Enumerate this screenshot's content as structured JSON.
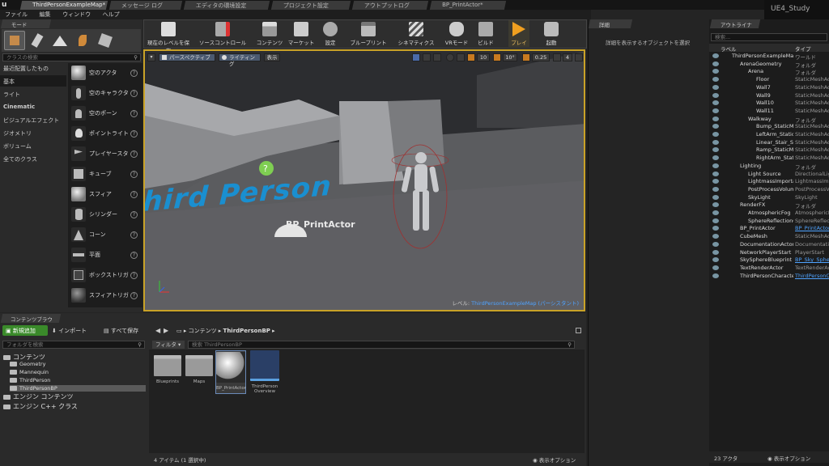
{
  "window_tabs": [
    "ThirdPersonExampleMap*",
    "メッセージ ログ",
    "エディタの環境設定",
    "プロジェクト設定",
    "アウトプットログ",
    "BP_PrintActor*"
  ],
  "app_title": "UE4_Study",
  "menu": [
    "ファイル",
    "編集",
    "ウィンドウ",
    "ヘルプ"
  ],
  "modes": {
    "tab": "モード",
    "search_placeholder": "クラスの検索",
    "categories": [
      "最近配置したもの",
      "基本",
      "ライト",
      "Cinematic",
      "ビジュアルエフェクト",
      "ジオメトリ",
      "ボリューム",
      "全てのクラス"
    ],
    "items": [
      "空のアクタ",
      "空のキャラクタ",
      "空のポーン",
      "ポイントライト",
      "プレイヤースタ",
      "キューブ",
      "スフィア",
      "シリンダー",
      "コーン",
      "平面",
      "ボックストリガ",
      "スフィアトリガ"
    ]
  },
  "toolbar": {
    "buttons": [
      "現在のレベルを保存",
      "ソースコントロール",
      "コンテンツ",
      "マーケット",
      "設定",
      "ブループリント",
      "シネマティクス",
      "VRモード",
      "ビルド",
      "プレイ",
      "起動"
    ]
  },
  "viewport": {
    "perspective": "パースペクティブ",
    "lighting": "ライティング",
    "show": "表示",
    "grid_snap": "10",
    "rot_snap": "10°",
    "scale_snap": "0.25",
    "cam_speed": "4",
    "floor_text": "Third Person",
    "actor_label": "BP_PrintActor",
    "level_label": "レベル:",
    "level_name": "ThirdPersonExampleMap (パーシスタント)"
  },
  "details": {
    "tab": "詳細",
    "empty": "詳細を表示するオブジェクトを選択"
  },
  "outliner": {
    "tab": "アウトライナ",
    "search_placeholder": "検索...",
    "col_label": "ラベル",
    "col_type": "タイプ",
    "rows": [
      {
        "name": "ThirdPersonExampleMap",
        "type": "ワールド",
        "indent": 0
      },
      {
        "name": "ArenaGeometry",
        "type": "フォルダ",
        "indent": 1
      },
      {
        "name": "Arena",
        "type": "フォルダ",
        "indent": 2
      },
      {
        "name": "Floor",
        "type": "StaticMeshActor",
        "indent": 3
      },
      {
        "name": "Wall7",
        "type": "StaticMeshActor",
        "indent": 3
      },
      {
        "name": "Wall9",
        "type": "StaticMeshActor",
        "indent": 3
      },
      {
        "name": "Wall10",
        "type": "StaticMeshActor",
        "indent": 3
      },
      {
        "name": "Wall11",
        "type": "StaticMeshActor",
        "indent": 3
      },
      {
        "name": "Walkway",
        "type": "フォルダ",
        "indent": 2
      },
      {
        "name": "Bump_StaticMesh",
        "type": "StaticMeshActor",
        "indent": 3
      },
      {
        "name": "LeftArm_StaticMes",
        "type": "StaticMeshActor",
        "indent": 3
      },
      {
        "name": "Linear_Stair_Static",
        "type": "StaticMeshActor",
        "indent": 3
      },
      {
        "name": "Ramp_StaticMesh",
        "type": "StaticMeshActor",
        "indent": 3
      },
      {
        "name": "RightArm_StaticMe",
        "type": "StaticMeshActor",
        "indent": 3
      },
      {
        "name": "Lighting",
        "type": "フォルダ",
        "indent": 1
      },
      {
        "name": "Light Source",
        "type": "DirectionalLight",
        "indent": 2
      },
      {
        "name": "LightmassImportanc",
        "type": "LightmassImportanceVolume",
        "indent": 2
      },
      {
        "name": "PostProcessVolume",
        "type": "PostProcessVolume",
        "indent": 2
      },
      {
        "name": "SkyLight",
        "type": "SkyLight",
        "indent": 2
      },
      {
        "name": "RenderFX",
        "type": "フォルダ",
        "indent": 1
      },
      {
        "name": "AtmosphericFog",
        "type": "AtmosphericFog",
        "indent": 2
      },
      {
        "name": "SphereReflectionCap",
        "type": "SphereReflectionCapture",
        "indent": 2
      },
      {
        "name": "BP_PrintActor",
        "type": "BP_PrintActor",
        "indent": 1,
        "link": true
      },
      {
        "name": "CubeMesh",
        "type": "StaticMeshActor",
        "indent": 1
      },
      {
        "name": "DocumentationActor1",
        "type": "DocumentationActor",
        "indent": 1
      },
      {
        "name": "NetworkPlayerStart",
        "type": "PlayerStart",
        "indent": 1
      },
      {
        "name": "SkySphereBlueprint",
        "type": "BP_Sky_Sphere",
        "indent": 1,
        "link": true
      },
      {
        "name": "TextRenderActor",
        "type": "TextRenderActor",
        "indent": 1
      },
      {
        "name": "ThirdPersonCharacter",
        "type": "ThirdPersonCharacter",
        "indent": 1,
        "link": true
      }
    ],
    "count": "23 アクタ",
    "view_options": "表示オプション"
  },
  "content_browser": {
    "tab": "コンテンツブラウザ",
    "add_new": "新規追加",
    "import": "インポート",
    "save_all": "すべて保存",
    "path": [
      "コンテンツ",
      "ThirdPersonBP"
    ],
    "folder_search": "フォルダを検索",
    "filter": "フィルタ",
    "asset_search": "検索 ThirdPersonBP",
    "tree": [
      {
        "label": "コンテンツ",
        "level": 0
      },
      {
        "label": "Geometry",
        "level": 1
      },
      {
        "label": "Mannequin",
        "level": 1
      },
      {
        "label": "ThirdPerson",
        "level": 1
      },
      {
        "label": "ThirdPersonBP",
        "level": 1,
        "selected": true
      },
      {
        "label": "エンジン コンテンツ",
        "level": 0
      },
      {
        "label": "エンジン C++ クラス",
        "level": 0
      }
    ],
    "assets": [
      "Blueprints",
      "Maps",
      "BP_PrintActor",
      "ThirdPerson Overview"
    ],
    "status": "4 アイテム (1 選択中)",
    "view_options": "表示オプション"
  },
  "colors": {
    "accent": "#f0a020",
    "selection": "#2c6fb3",
    "green_btn": "#3a8a2a",
    "link": "#4fa3ff",
    "floor_text": "#1a8fd0"
  }
}
